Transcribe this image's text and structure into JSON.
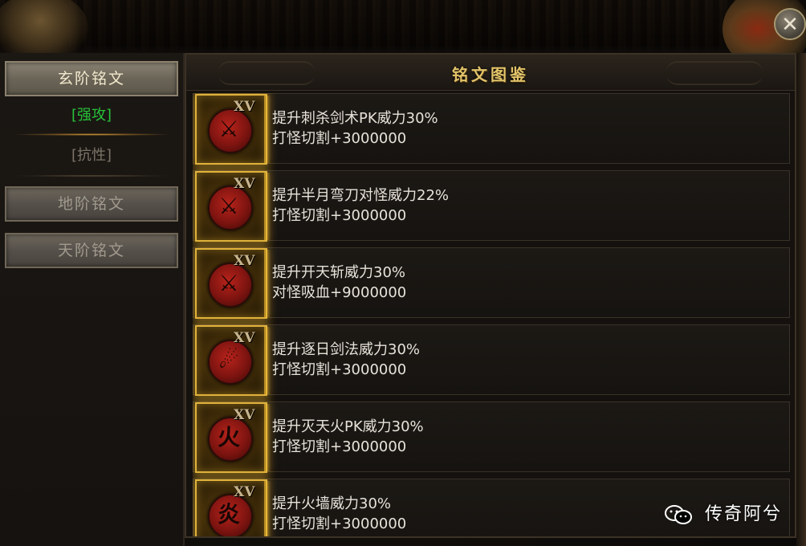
{
  "close_icon": "✕",
  "sidebar": {
    "xuan_label": "玄阶铭文",
    "qianggong_label": "[强攻]",
    "kangxing_label": "[抗性]",
    "di_label": "地阶铭文",
    "tian_label": "天阶铭文"
  },
  "panel": {
    "title": "铭文图鉴"
  },
  "rows": [
    {
      "tier": "XV",
      "icon": "slash-seal-icon",
      "glyph": "⚔",
      "line1": "提升刺杀剑术PK威力30%",
      "line2": "打怪切割+3000000"
    },
    {
      "tier": "XV",
      "icon": "blade-seal-icon",
      "glyph": "⚔",
      "line1": "提升半月弯刀对怪威力22%",
      "line2": "打怪切割+3000000"
    },
    {
      "tier": "XV",
      "icon": "cleave-seal-icon",
      "glyph": "⚔",
      "line1": "提升开天斩威力30%",
      "line2": "对怪吸血+9000000"
    },
    {
      "tier": "XV",
      "icon": "sun-chase-seal-icon",
      "glyph": "☄",
      "line1": "提升逐日剑法威力30%",
      "line2": "打怪切割+3000000"
    },
    {
      "tier": "XV",
      "icon": "flame-seal-icon",
      "glyph": "火",
      "line1": "提升灭天火PK威力30%",
      "line2": "打怪切割+3000000"
    },
    {
      "tier": "XV",
      "icon": "firewall-seal-icon",
      "glyph": "炎",
      "line1": "提升火墙威力30%",
      "line2": "打怪切割+3000000"
    }
  ],
  "watermark": {
    "text": "传奇阿兮",
    "icon": "wechat-icon"
  },
  "colors": {
    "accent_gold": "#e2c36a",
    "active_green": "#27c23a",
    "icon_frame": "#e0b23c"
  }
}
